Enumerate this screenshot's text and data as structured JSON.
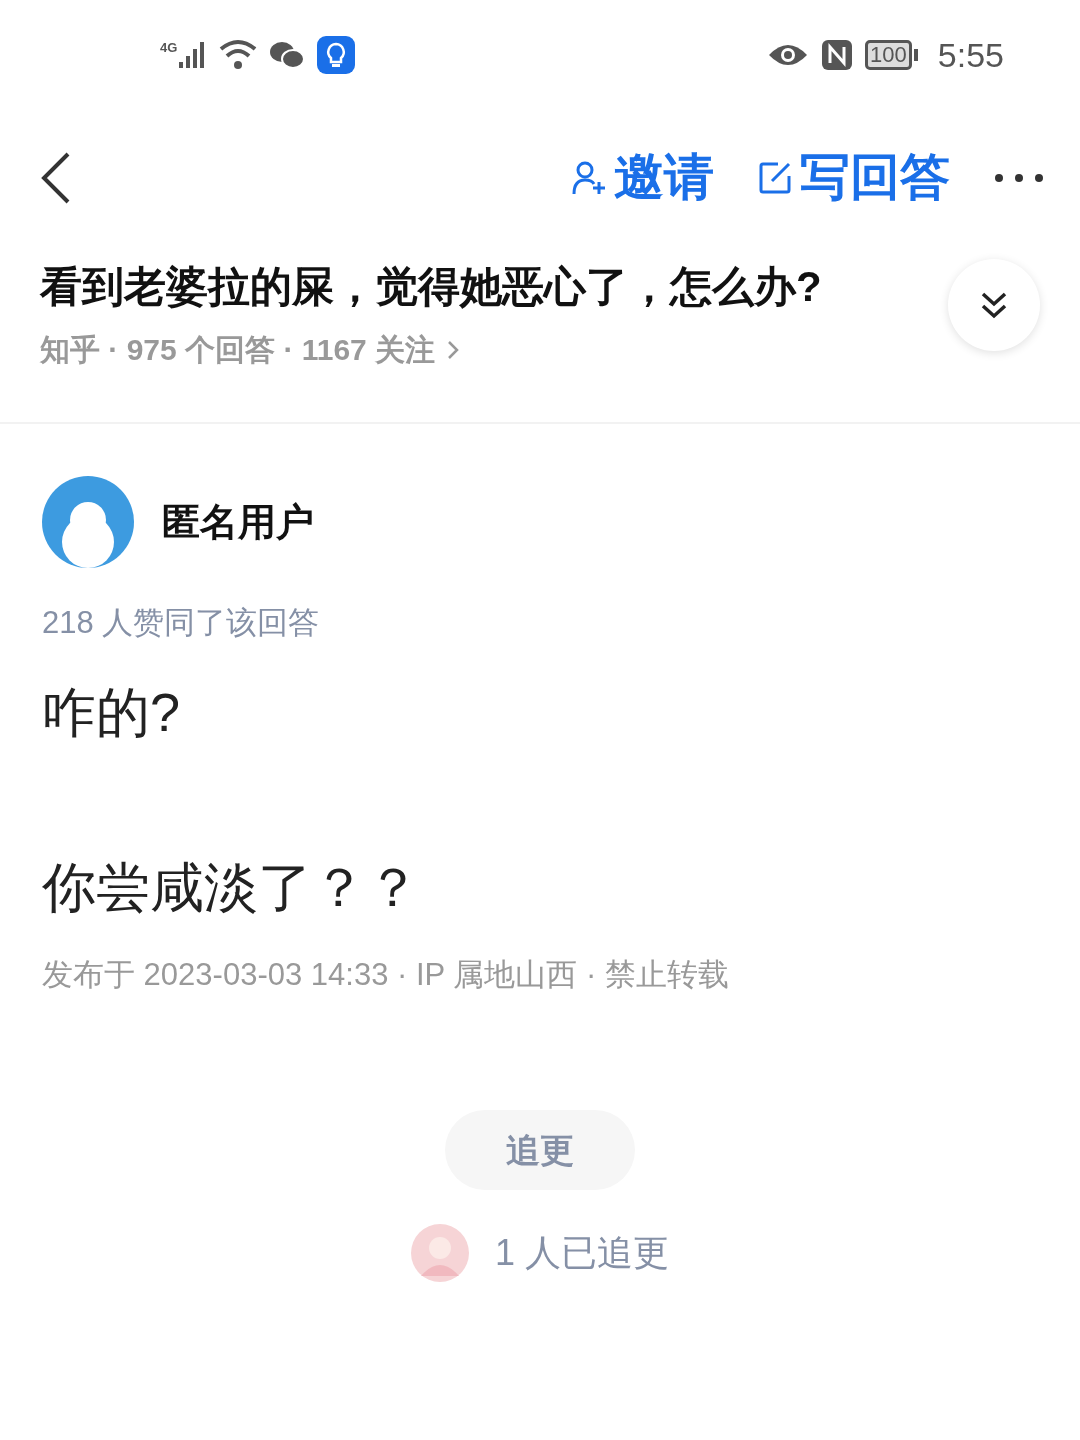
{
  "status_bar": {
    "network": "4G",
    "battery": "100",
    "time": "5:55"
  },
  "nav": {
    "actions": [
      {
        "kind": "invite",
        "label": "邀请"
      },
      {
        "kind": "write",
        "label": "写回答"
      }
    ]
  },
  "question": {
    "title": "看到老婆拉的屎，觉得她恶心了，怎么办?",
    "meta": "知乎 · 975 个回答 · 1167 关注"
  },
  "answer": {
    "author": "匿名用户",
    "votes": "218 人赞同了该回答",
    "paragraphs": [
      "咋的?",
      "你尝咸淡了？？"
    ],
    "footer": "发布于 2023-03-03 14:33 · IP 属地山西 · 禁止转载"
  },
  "follow_button": {
    "label": "追更"
  },
  "followers": "1 人已追更"
}
